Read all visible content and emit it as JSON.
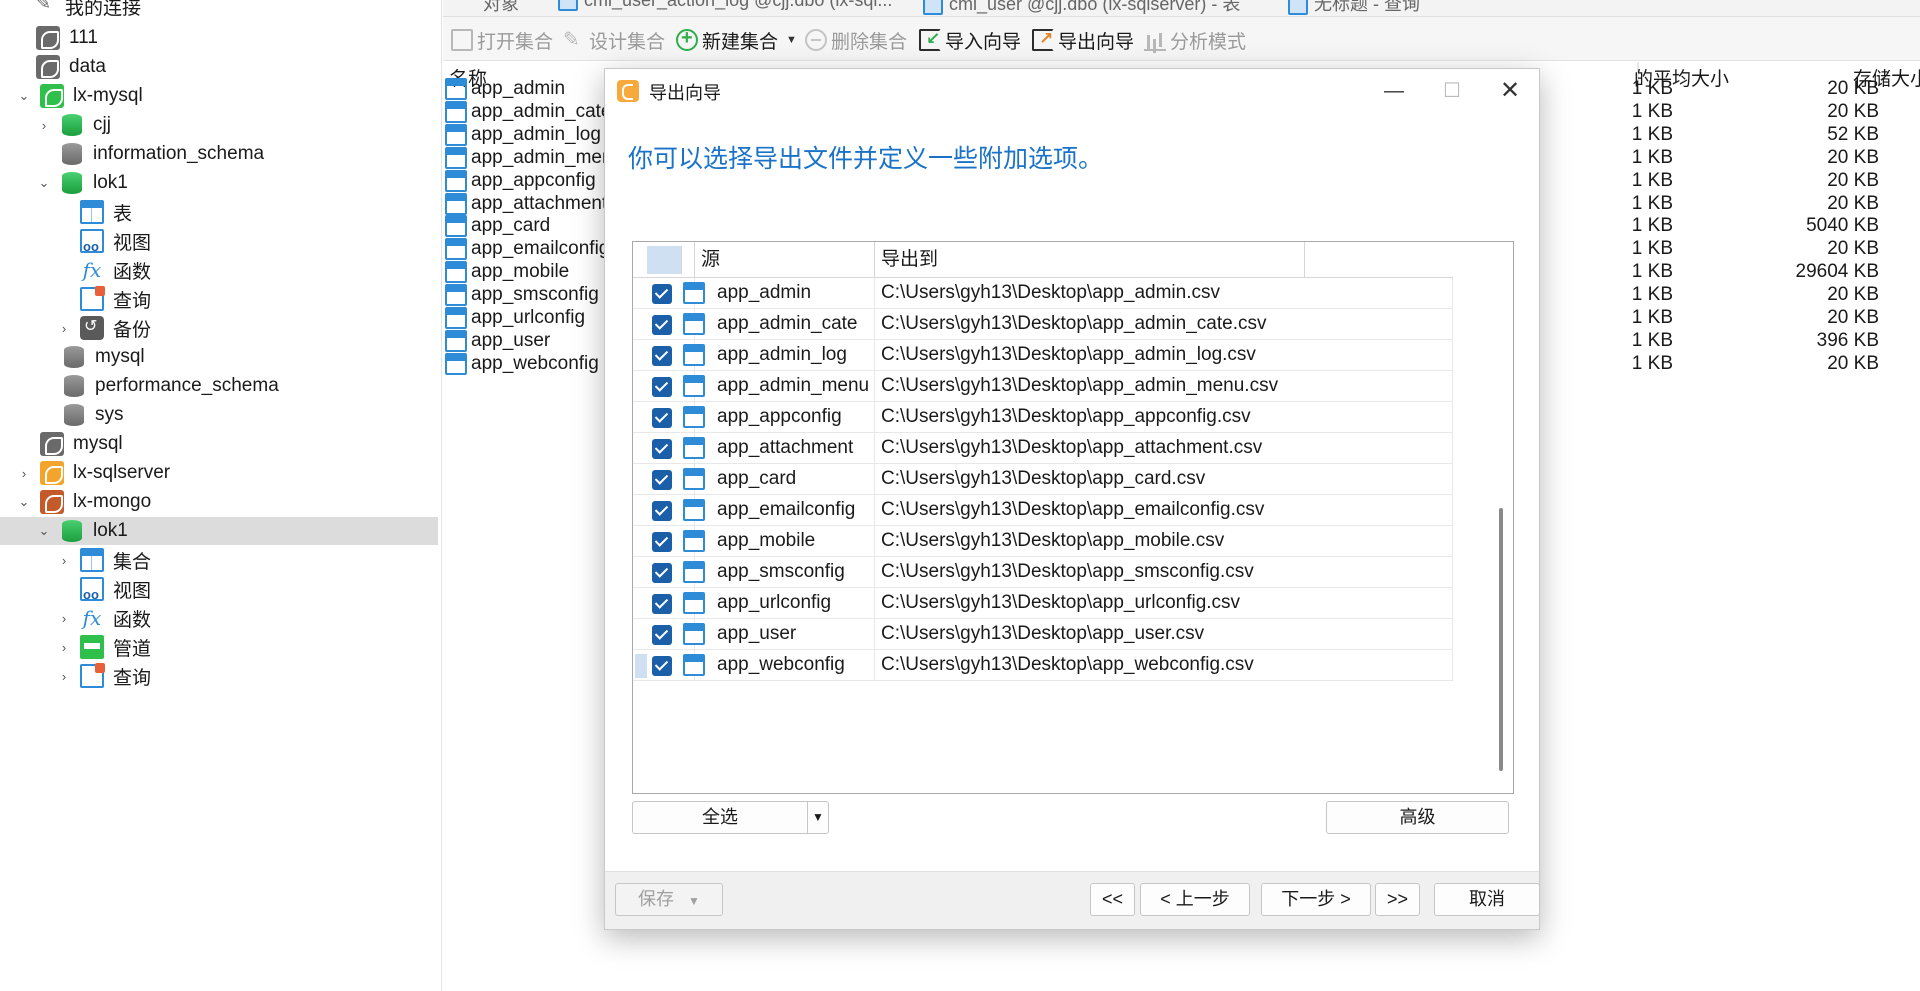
{
  "sidebar": {
    "items": [
      {
        "label": "我的连接",
        "icon": "connection-icon"
      },
      {
        "label": "111",
        "icon": "mysql-connection-icon"
      },
      {
        "label": "data",
        "icon": "mysql-connection-icon"
      },
      {
        "label": "lx-mysql",
        "icon": "mysql-connection-icon"
      },
      {
        "label": "cjj",
        "icon": "database-icon"
      },
      {
        "label": "information_schema",
        "icon": "database-icon"
      },
      {
        "label": "lok1",
        "icon": "database-icon"
      },
      {
        "label": "表",
        "icon": "table-icon"
      },
      {
        "label": "视图",
        "icon": "view-icon"
      },
      {
        "label": "函数",
        "icon": "function-icon"
      },
      {
        "label": "查询",
        "icon": "query-icon"
      },
      {
        "label": "备份",
        "icon": "backup-icon"
      },
      {
        "label": "mysql",
        "icon": "database-icon"
      },
      {
        "label": "performance_schema",
        "icon": "database-icon"
      },
      {
        "label": "sys",
        "icon": "database-icon"
      },
      {
        "label": "mysql",
        "icon": "mysql-connection-icon"
      },
      {
        "label": "lx-sqlserver",
        "icon": "sqlserver-connection-icon"
      },
      {
        "label": "lx-mongo",
        "icon": "mongo-connection-icon"
      },
      {
        "label": "lok1",
        "icon": "database-icon"
      },
      {
        "label": "集合",
        "icon": "collection-icon"
      },
      {
        "label": "视图",
        "icon": "view-icon"
      },
      {
        "label": "函数",
        "icon": "function-icon"
      },
      {
        "label": "管道",
        "icon": "pipeline-icon"
      },
      {
        "label": "查询",
        "icon": "query-icon"
      }
    ]
  },
  "tabs": [
    {
      "label": "对象"
    },
    {
      "label": "cml_user_action_log @cjj.dbo (lx-sql..."
    },
    {
      "label": "cml_user @cjj.dbo (lx-sqlserver) - 表"
    },
    {
      "label": "无标题 - 查询"
    }
  ],
  "toolbar": {
    "open_collection": "打开集合",
    "design_collection": "设计集合",
    "new_collection": "新建集合",
    "delete_collection": "删除集合",
    "import_wizard": "导入向导",
    "export_wizard": "导出向导",
    "analyze_mode": "分析模式"
  },
  "list": {
    "headers": {
      "name": "名称",
      "avg_size": "的平均大小",
      "storage_size": "存储大小"
    },
    "rows": [
      {
        "name": "app_admin",
        "avg": "1 KB",
        "storage": "20 KB"
      },
      {
        "name": "app_admin_cate",
        "avg": "1 KB",
        "storage": "20 KB"
      },
      {
        "name": "app_admin_log",
        "avg": "1 KB",
        "storage": "52 KB"
      },
      {
        "name": "app_admin_menu",
        "avg": "1 KB",
        "storage": "20 KB"
      },
      {
        "name": "app_appconfig",
        "avg": "1 KB",
        "storage": "20 KB"
      },
      {
        "name": "app_attachment",
        "avg": "1 KB",
        "storage": "20 KB"
      },
      {
        "name": "app_card",
        "avg": "1 KB",
        "storage": "5040 KB"
      },
      {
        "name": "app_emailconfig",
        "avg": "1 KB",
        "storage": "20 KB"
      },
      {
        "name": "app_mobile",
        "avg": "1 KB",
        "storage": "29604 KB"
      },
      {
        "name": "app_smsconfig",
        "avg": "1 KB",
        "storage": "20 KB"
      },
      {
        "name": "app_urlconfig",
        "avg": "1 KB",
        "storage": "20 KB"
      },
      {
        "name": "app_user",
        "avg": "1 KB",
        "storage": "396 KB"
      },
      {
        "name": "app_webconfig",
        "avg": "1 KB",
        "storage": "20 KB"
      }
    ]
  },
  "dialog": {
    "title": "导出向导",
    "headline": "你可以选择导出文件并定义一些附加选项。",
    "grid_headers": {
      "source": "源",
      "export_to": "导出到"
    },
    "rows": [
      {
        "source": "app_admin",
        "target": "C:\\Users\\gyh13\\Desktop\\app_admin.csv",
        "checked": true
      },
      {
        "source": "app_admin_cate",
        "target": "C:\\Users\\gyh13\\Desktop\\app_admin_cate.csv",
        "checked": true
      },
      {
        "source": "app_admin_log",
        "target": "C:\\Users\\gyh13\\Desktop\\app_admin_log.csv",
        "checked": true
      },
      {
        "source": "app_admin_menu",
        "target": "C:\\Users\\gyh13\\Desktop\\app_admin_menu.csv",
        "checked": true
      },
      {
        "source": "app_appconfig",
        "target": "C:\\Users\\gyh13\\Desktop\\app_appconfig.csv",
        "checked": true
      },
      {
        "source": "app_attachment",
        "target": "C:\\Users\\gyh13\\Desktop\\app_attachment.csv",
        "checked": true
      },
      {
        "source": "app_card",
        "target": "C:\\Users\\gyh13\\Desktop\\app_card.csv",
        "checked": true
      },
      {
        "source": "app_emailconfig",
        "target": "C:\\Users\\gyh13\\Desktop\\app_emailconfig.csv",
        "checked": true
      },
      {
        "source": "app_mobile",
        "target": "C:\\Users\\gyh13\\Desktop\\app_mobile.csv",
        "checked": true
      },
      {
        "source": "app_smsconfig",
        "target": "C:\\Users\\gyh13\\Desktop\\app_smsconfig.csv",
        "checked": true
      },
      {
        "source": "app_urlconfig",
        "target": "C:\\Users\\gyh13\\Desktop\\app_urlconfig.csv",
        "checked": true
      },
      {
        "source": "app_user",
        "target": "C:\\Users\\gyh13\\Desktop\\app_user.csv",
        "checked": true
      },
      {
        "source": "app_webconfig",
        "target": "C:\\Users\\gyh13\\Desktop\\app_webconfig.csv",
        "checked": true
      }
    ],
    "select_all": "全选",
    "advanced": "高级",
    "save": "保存",
    "first": "<<",
    "prev": "< 上一步",
    "next": "下一步 >",
    "last": ">>",
    "cancel": "取消"
  },
  "colors": {
    "accent": "#1a73c9",
    "checkbox": "#1a5fa8",
    "selection": "#dcdcdc"
  }
}
